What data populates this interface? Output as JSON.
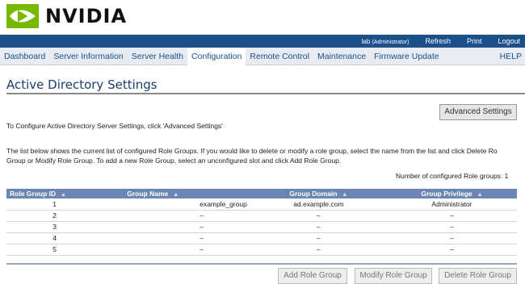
{
  "header": {
    "logo_text": "NVIDIA",
    "user_label": "lab",
    "user_role": "(Administrator)",
    "refresh": "Refresh",
    "print": "Print",
    "logout": "Logout"
  },
  "nav": {
    "tabs": [
      "Dashboard",
      "Server Information",
      "Server Health",
      "Configuration",
      "Remote Control",
      "Maintenance",
      "Firmware Update"
    ],
    "active": "Configuration",
    "help": "HELP"
  },
  "page": {
    "title": "Active Directory Settings",
    "advanced_button": "Advanced Settings",
    "config_text": "To Configure Active Directory Server Settings, click 'Advanced Settings'",
    "list_text_1": "The list below shows the current list of configured Role Groups. If you would like to delete or modify a role group, select the name from the list and click Delete Ro",
    "list_text_2": "Group or Modify Role Group. To add a new Role Group, select an unconfigured slot and click Add Role Group.",
    "count_text": "Number of configured Role groups: 1"
  },
  "table": {
    "headers": [
      "Role Group ID",
      "Group Name",
      "Group Domain",
      "Group Privilege"
    ],
    "sort_icon": "▲",
    "rows": [
      [
        "1",
        "example_group",
        "ad.example.com",
        "Administrator"
      ],
      [
        "2",
        "–",
        "–",
        "–"
      ],
      [
        "3",
        "–",
        "–",
        "–"
      ],
      [
        "4",
        "–",
        "–",
        "–"
      ],
      [
        "5",
        "–",
        "–",
        "–"
      ]
    ]
  },
  "actions": {
    "add": "Add Role Group",
    "modify": "Modify Role Group",
    "delete": "Delete Role Group"
  },
  "colors": {
    "brand_green": "#76b900",
    "topbar_blue": "#1a4f8b",
    "table_header": "#6a86b2"
  }
}
